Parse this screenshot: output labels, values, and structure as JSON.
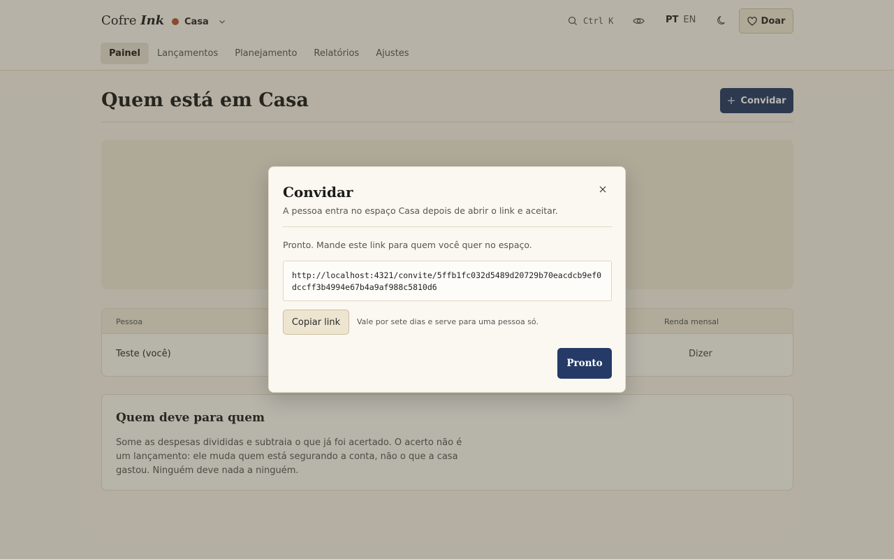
{
  "header": {
    "brand_plain": "Cofre",
    "brand_italic": "Ink",
    "space": {
      "name": "Casa",
      "dot_color": "#b5562e"
    },
    "search_shortcut": "Ctrl K",
    "lang": {
      "active": "PT",
      "other": "EN"
    },
    "donate_label": "Doar"
  },
  "tabs": [
    {
      "label": "Painel",
      "active": true
    },
    {
      "label": "Lançamentos"
    },
    {
      "label": "Planejamento"
    },
    {
      "label": "Relatórios"
    },
    {
      "label": "Ajustes"
    }
  ],
  "page": {
    "title": "Quem está em Casa",
    "invite_label": "Convidar"
  },
  "people_table": {
    "headers": {
      "person": "Pessoa",
      "income": "Renda mensal"
    },
    "rows": [
      {
        "person": "Teste (você)",
        "income": "Dizer"
      }
    ]
  },
  "debts": {
    "title": "Quem deve para quem",
    "text": "Some as despesas divididas e subtraia o que já foi acertado. O acerto não é um lançamento: ele muda quem está segurando a conta, não o que a casa gastou. Ninguém deve nada a ninguém."
  },
  "modal": {
    "title": "Convidar",
    "subtitle": "A pessoa entra no espaço Casa depois de abrir o link e aceitar.",
    "note": "Pronto. Mande este link para quem você quer no espaço.",
    "link": "http://localhost:4321/convite/5ffb1fc032d5489d20729b70eacdcb9ef0dccff3b4994e67b4a9af988c5810d6",
    "copy_label": "Copiar link",
    "copy_hint": "Vale por sete dias e serve para uma pessoa só.",
    "done_label": "Pronto"
  },
  "colors": {
    "primary": "#253a66",
    "accent_dot": "#b5562e",
    "background": "#f7f3e8"
  }
}
